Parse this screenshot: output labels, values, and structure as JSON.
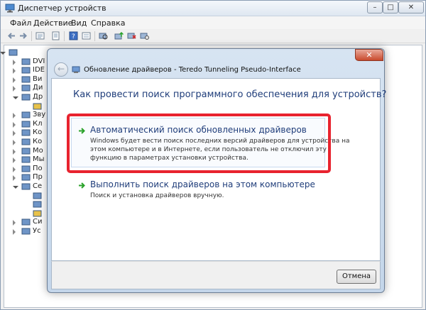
{
  "window": {
    "title": "Диспетчер устройств",
    "buttons": {
      "minimize": "–",
      "maximize": "□",
      "close": "✕"
    }
  },
  "menu": [
    "Файл",
    "Действие",
    "Вид",
    "Справка"
  ],
  "toolbar": {
    "icons": [
      "back-icon",
      "forward-icon",
      "tree-view-icon",
      "properties-icon",
      "help-icon",
      "list-view-icon",
      "scan-hardware-icon",
      "update-driver-icon",
      "disable-device-icon",
      "uninstall-icon"
    ]
  },
  "tree": {
    "rows": [
      {
        "label": "",
        "icon": "computer-icon"
      },
      {
        "label": "DVI",
        "icon": "dvd-drive-icon"
      },
      {
        "label": "IDE",
        "icon": "ide-controller-icon"
      },
      {
        "label": "Ви",
        "icon": "display-adapter-icon"
      },
      {
        "label": "Ди",
        "icon": "disk-drive-icon"
      },
      {
        "label": "Др",
        "icon": "other-devices-icon"
      },
      {
        "label": "",
        "icon": "unknown-device-icon"
      },
      {
        "label": "Зву",
        "icon": "sound-icon"
      },
      {
        "label": "Кл",
        "icon": "keyboard-icon"
      },
      {
        "label": "Ко",
        "icon": "computer-icon"
      },
      {
        "label": "Ко",
        "icon": "usb-controller-icon"
      },
      {
        "label": "Мо",
        "icon": "monitor-icon"
      },
      {
        "label": "Мы",
        "icon": "mouse-icon"
      },
      {
        "label": "По",
        "icon": "port-icon"
      },
      {
        "label": "Пр",
        "icon": "processor-icon"
      },
      {
        "label": "Се",
        "icon": "network-adapter-icon"
      },
      {
        "label": "",
        "icon": "network-device-icon"
      },
      {
        "label": "",
        "icon": "network-device-icon"
      },
      {
        "label": "",
        "icon": "network-device-warning-icon"
      },
      {
        "label": "Си",
        "icon": "system-devices-icon"
      },
      {
        "label": "Ус",
        "icon": "hid-device-icon"
      }
    ]
  },
  "dialog": {
    "title": "Обновление драйверов - Teredo Tunneling Pseudo-Interface",
    "question": "Как провести поиск программного обеспечения для устройств?",
    "option_auto": {
      "title": "Автоматический поиск обновленных драйверов",
      "desc_line1": "Windows будет вести поиск последних версий драйверов для устройства на",
      "desc_line2": "этом компьютере и в Интернете, если пользователь не отключил эту",
      "desc_line3": "функцию в параметрах установки устройства."
    },
    "option_manual": {
      "title": "Выполнить поиск драйверов на этом компьютере",
      "desc": "Поиск и установка драйверов вручную."
    },
    "cancel_label": "Отмена",
    "close_glyph": "✕",
    "back_glyph": "←"
  },
  "colors": {
    "highlight": "#e8232f",
    "link_blue": "#1f3d7a",
    "arrow_green": "#2aa22a"
  }
}
